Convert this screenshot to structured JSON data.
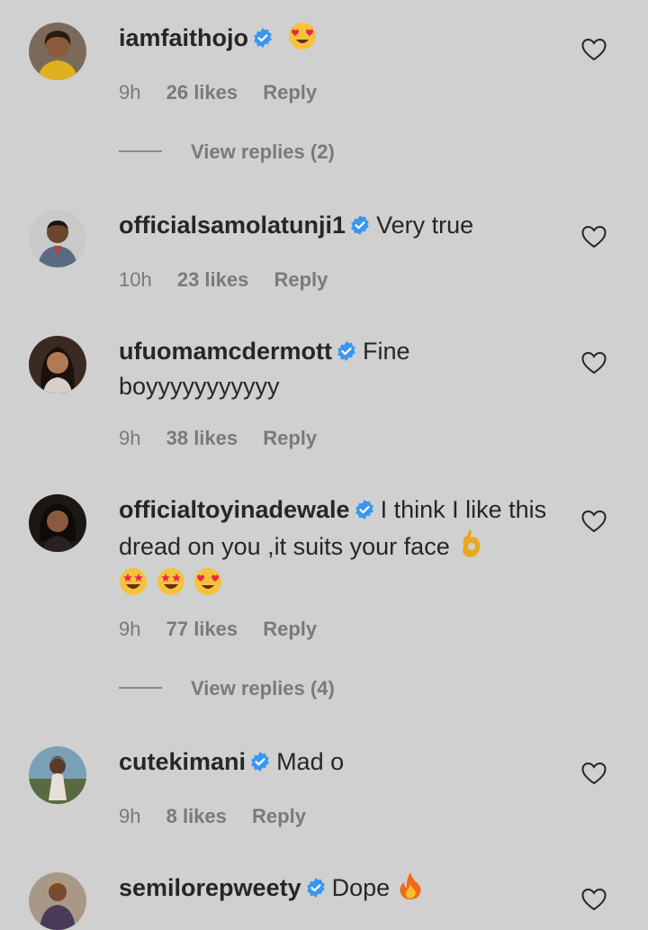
{
  "comments": [
    {
      "username": "iamfaithojo",
      "text": "",
      "emojis": [
        "heart-eyes"
      ],
      "time": "9h",
      "likes": "26 likes",
      "reply": "Reply",
      "view_replies": "View replies (2)"
    },
    {
      "username": "officialsamolatunji1",
      "text": "Very true",
      "emojis": [],
      "time": "10h",
      "likes": "23 likes",
      "reply": "Reply"
    },
    {
      "username": "ufuomamcdermott",
      "text": "Fine boyyyyyyyyyyy",
      "emojis": [],
      "time": "9h",
      "likes": "38 likes",
      "reply": "Reply"
    },
    {
      "username": "officialtoyinadewale",
      "text": "I think I like this dread on you ,it suits your face",
      "emojis": [
        "ok-hand",
        "star-struck",
        "star-struck",
        "heart-eyes"
      ],
      "time": "9h",
      "likes": "77 likes",
      "reply": "Reply",
      "view_replies": "View replies (4)"
    },
    {
      "username": "cutekimani",
      "text": "Mad o",
      "emojis": [],
      "time": "9h",
      "likes": "8 likes",
      "reply": "Reply"
    },
    {
      "username": "semilorepweety",
      "text": "Dope",
      "emojis": [
        "fire"
      ]
    }
  ],
  "colors": {
    "background": "#d0d0d0",
    "text": "#262626",
    "meta": "#7a7a7a",
    "verified": "#3897f0"
  },
  "icons": {
    "verified": "verified-badge-icon",
    "like": "heart-outline-icon"
  }
}
